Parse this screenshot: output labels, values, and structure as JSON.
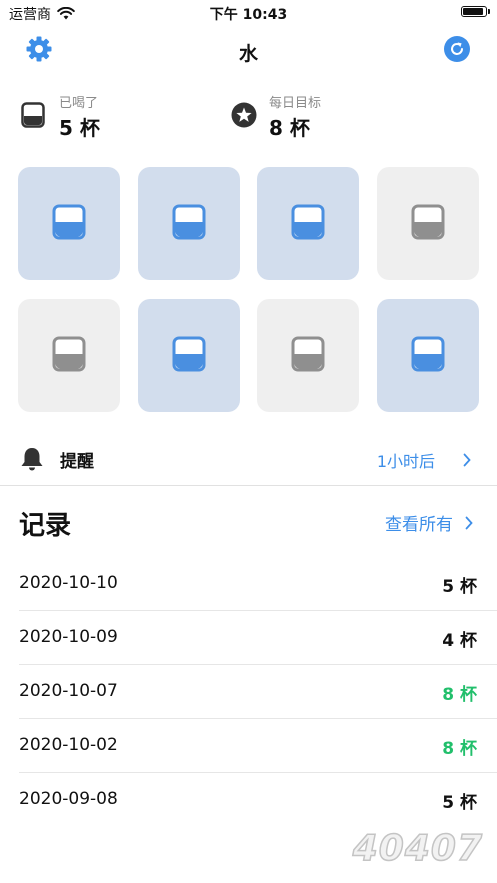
{
  "status_bar": {
    "carrier": "运营商",
    "time": "下午 10:43",
    "battery_level": 1.0
  },
  "nav": {
    "title": "水",
    "left_icon": "gear-icon",
    "right_icon": "refresh-icon"
  },
  "stats": {
    "drunk": {
      "label": "已喝了",
      "value": "5 杯",
      "icon": "cup-icon"
    },
    "goal": {
      "label": "每日目标",
      "value": "8 杯",
      "icon": "star-icon"
    }
  },
  "cups": [
    {
      "filled": true
    },
    {
      "filled": true
    },
    {
      "filled": true
    },
    {
      "filled": false
    },
    {
      "filled": false
    },
    {
      "filled": true
    },
    {
      "filled": false
    },
    {
      "filled": true
    }
  ],
  "reminder": {
    "label": "提醒",
    "value": "1小时后",
    "icon": "bell-icon"
  },
  "records": {
    "title": "记录",
    "view_all": "查看所有",
    "items": [
      {
        "date": "2020-10-10",
        "count": "5 杯",
        "goal_met": false
      },
      {
        "date": "2020-10-09",
        "count": "4 杯",
        "goal_met": false
      },
      {
        "date": "2020-10-07",
        "count": "8 杯",
        "goal_met": true
      },
      {
        "date": "2020-10-02",
        "count": "8 杯",
        "goal_met": true
      },
      {
        "date": "2020-09-08",
        "count": "5 杯",
        "goal_met": false
      }
    ]
  },
  "watermark": "40407",
  "colors": {
    "accent": "#3d8ee8",
    "cup_water": "#4a8fe0",
    "cup_full_bg": "#d2dded",
    "cup_empty_bg": "#efefef",
    "cup_empty_fill": "#8f8f8f",
    "goal_met": "#21bf6b",
    "text": "#111111"
  }
}
